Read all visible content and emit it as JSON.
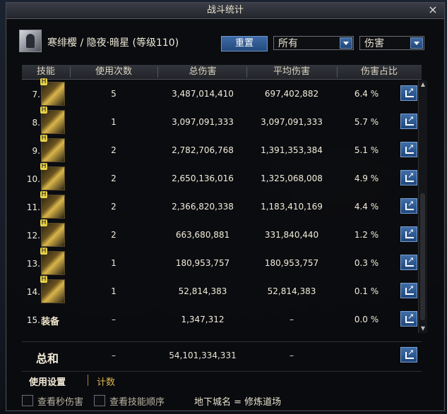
{
  "window": {
    "title": "战斗统计",
    "close_icon": "×"
  },
  "header": {
    "character": "寒绯樱 / 隐夜·暗星 (等级110)",
    "reset_label": "重置",
    "filter_value": "所有",
    "mode_value": "伤害"
  },
  "table": {
    "columns": [
      "技能",
      "使用次数",
      "总伤害",
      "平均伤害",
      "伤害占比"
    ],
    "rows": [
      {
        "index": "7.",
        "icon": "lightning-slash-skill-icon",
        "uses": "5",
        "total": "3,487,014,410",
        "avg": "697,402,882",
        "share": "6.4  %"
      },
      {
        "index": "8.",
        "icon": "burst-star-skill-icon",
        "uses": "1",
        "total": "3,097,091,333",
        "avg": "3,097,091,333",
        "share": "5.7  %"
      },
      {
        "index": "9.",
        "icon": "crossed-blades-skill-icon",
        "uses": "2",
        "total": "2,782,706,768",
        "avg": "1,391,353,384",
        "share": "5.1  %"
      },
      {
        "index": "10.",
        "icon": "golden-wave-skill-icon",
        "uses": "2",
        "total": "2,650,136,016",
        "avg": "1,325,068,008",
        "share": "4.9  %"
      },
      {
        "index": "11.",
        "icon": "lightning-claw-skill-icon",
        "uses": "2",
        "total": "2,366,820,338",
        "avg": "1,183,410,169",
        "share": "4.4  %"
      },
      {
        "index": "12.",
        "icon": "dagger-strike-skill-icon",
        "uses": "2",
        "total": "663,680,881",
        "avg": "331,840,440",
        "share": "1.2  %"
      },
      {
        "index": "13.",
        "icon": "explosion-skill-icon",
        "uses": "1",
        "total": "180,953,757",
        "avg": "180,953,757",
        "share": "0.3  %"
      },
      {
        "index": "14.",
        "icon": "twin-blade-skill-icon",
        "uses": "1",
        "total": "52,814,383",
        "avg": "52,814,383",
        "share": "0.1  %"
      },
      {
        "index": "15.",
        "equip": "装备",
        "uses": "–",
        "total": "1,347,312",
        "avg": "–",
        "share": "0.0  %"
      }
    ],
    "total": {
      "label": "总和",
      "uses": "–",
      "total": "54,101,334,331",
      "avg": "–"
    }
  },
  "tabs": {
    "settings": "使用设置",
    "count": "计数"
  },
  "footer": {
    "dps_label": "查看秒伤害",
    "order_label": "查看技能顺序",
    "dungeon": "地下城名 = 修炼道场"
  },
  "colors": {
    "accent_blue": "#2f5a92",
    "gold": "#a8862c",
    "text": "#e8e2d0"
  }
}
